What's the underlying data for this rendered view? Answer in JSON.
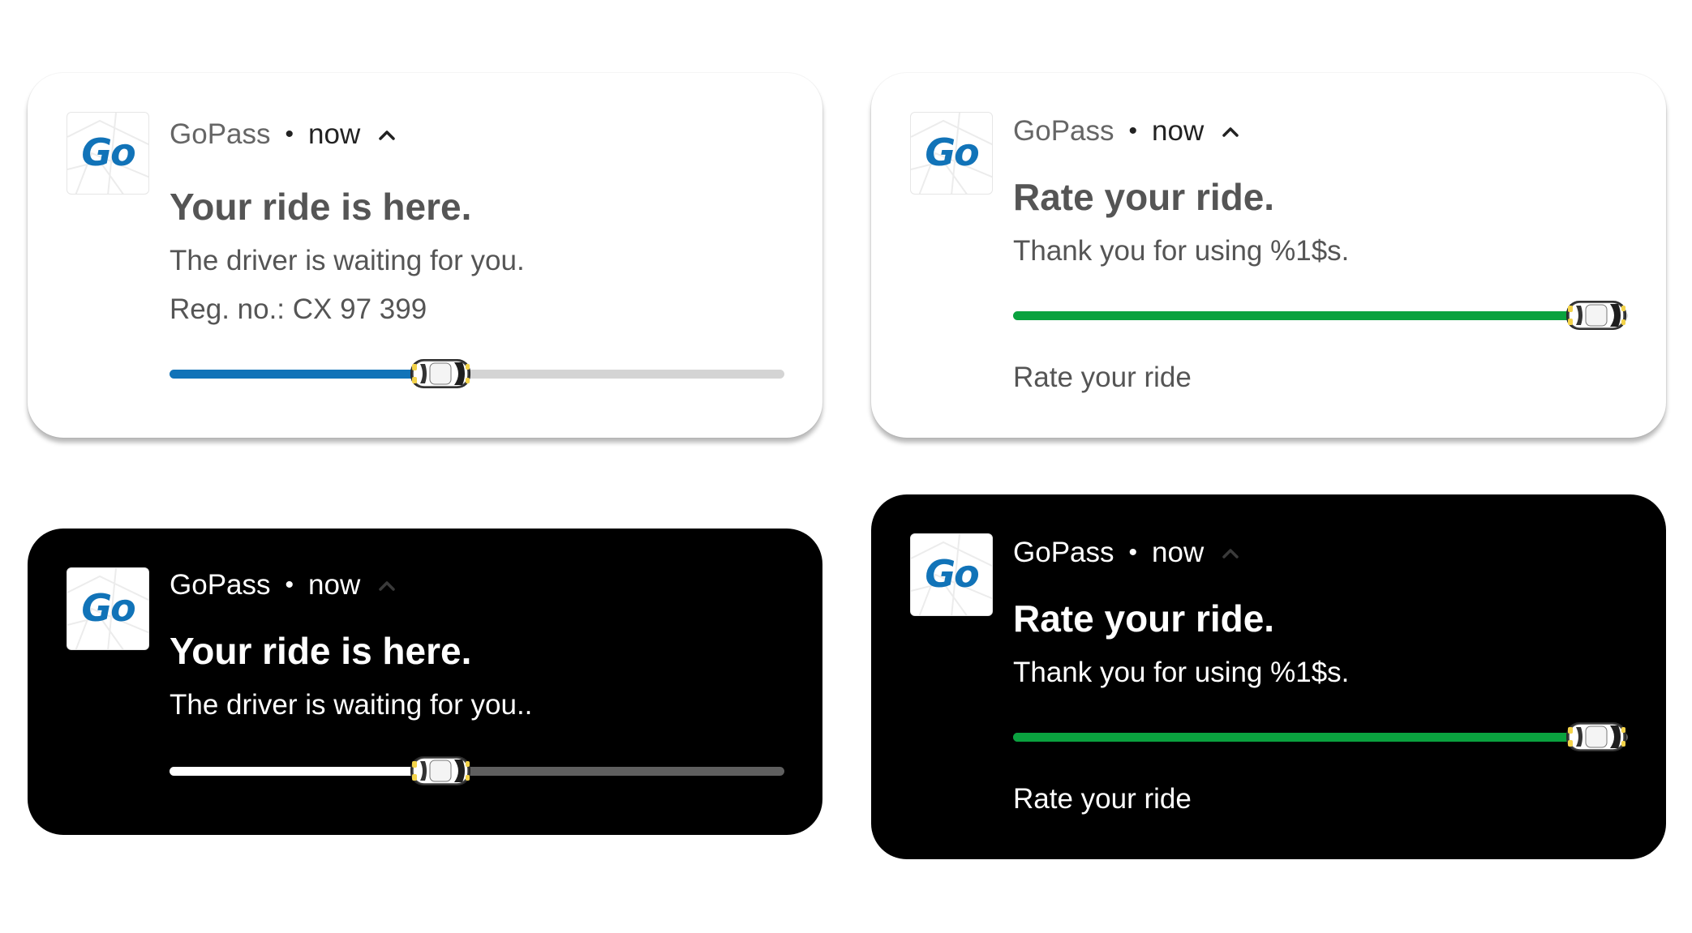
{
  "colors": {
    "brand_blue": "#1173b8",
    "progress_blue": "#1173b8",
    "progress_green": "#0aa23f",
    "track_light": "#d4d4d4",
    "track_dark": "#5f5f5f",
    "fill_dark": "#ffffff"
  },
  "icons": {
    "app_icon": "gopass-logo-icon",
    "expand": "chevron-up-icon",
    "progress_marker": "car-icon"
  },
  "notifications": [
    {
      "theme": "light",
      "app_icon_text": "Go",
      "app_name": "GoPass",
      "separator": "•",
      "time": "now",
      "title": "Your ride is here.",
      "body": "The driver is waiting for you.",
      "detail": "Reg. no.: CX 97 399",
      "progress": 0.44
    },
    {
      "theme": "light",
      "app_icon_text": "Go",
      "app_name": "GoPass",
      "separator": "•",
      "time": "now",
      "title": "Rate your ride.",
      "body": "Thank you for using %1$s.",
      "progress": 1.0,
      "action": "Rate your ride"
    },
    {
      "theme": "dark",
      "app_icon_text": "Go",
      "app_name": "GoPass",
      "separator": "•",
      "time": "now",
      "title": "Your ride is here.",
      "body": "The driver is waiting for you..",
      "progress": 0.44
    },
    {
      "theme": "dark",
      "app_icon_text": "Go",
      "app_name": "GoPass",
      "separator": "•",
      "time": "now",
      "title": "Rate your ride.",
      "body": "Thank you for using %1$s.",
      "progress": 1.0,
      "action": "Rate your ride"
    }
  ]
}
